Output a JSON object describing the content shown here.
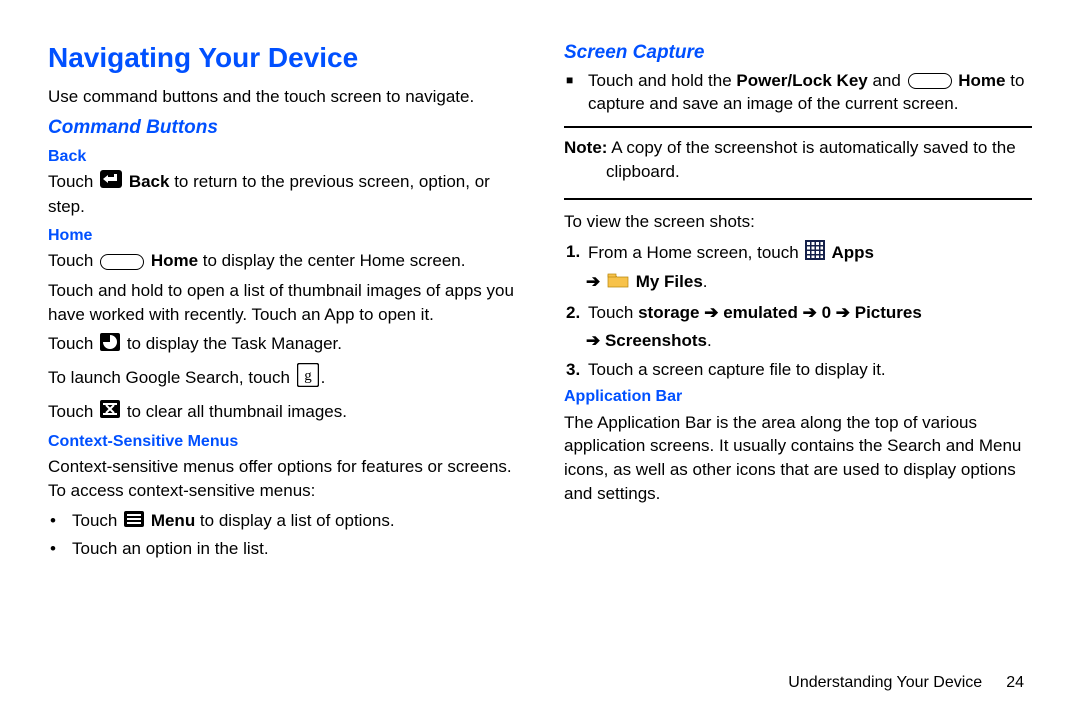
{
  "left": {
    "h1": "Navigating Your Device",
    "intro": "Use command buttons and the touch screen to navigate.",
    "h2_command": "Command Buttons",
    "back": {
      "heading": "Back",
      "p1a": "Touch ",
      "p1b": " Back",
      "p1c": " to return to the previous screen, option, or step."
    },
    "home": {
      "heading": "Home",
      "p1a": "Touch ",
      "p1b": " Home",
      "p1c": " to display the center Home screen.",
      "p2": "Touch and hold to open a list of thumbnail images of apps you have worked with recently. Touch an App to open it.",
      "p3a": "Touch ",
      "p3b": " to display the Task Manager.",
      "p4a": "To launch Google Search, touch ",
      "p4b": ".",
      "p5a": "Touch ",
      "p5b": " to clear all thumbnail images."
    },
    "context": {
      "heading": "Context-Sensitive Menus",
      "p1": "Context-sensitive menus offer options for features or screens. To access context-sensitive menus:",
      "b1a": "Touch ",
      "b1b": " Menu",
      "b1c": " to display a list of options.",
      "b2": "Touch an option in the list."
    }
  },
  "right": {
    "h2_screen": "Screen Capture",
    "cap1a": "Touch and hold the ",
    "cap1b": "Power/Lock Key",
    "cap1c": " and ",
    "cap1d": " Home",
    "cap1e": " to capture and save an image of the current screen.",
    "note_label": "Note:",
    "note_body": " A copy of the screenshot is automatically saved to the clipboard.",
    "view_intro": "To view the screen shots:",
    "s1a": "From a Home screen, touch ",
    "s1b": " Apps",
    "s1arrow": "➔ ",
    "s1c": " My Files",
    "s1d": ".",
    "s2a": "Touch ",
    "s2b": "storage",
    "s2c": " ➔ ",
    "s2d": "emulated",
    "s2e": " ➔ ",
    "s2f": "0",
    "s2g": " ➔ ",
    "s2h": "Pictures",
    "s2i": "➔ Screenshots",
    "s2j": ".",
    "s3": "Touch a screen capture file to display it.",
    "appbar": {
      "heading": "Application Bar",
      "p1": "The Application Bar is the area along the top of various application screens. It usually contains the Search and Menu icons, as well as other icons that are used to display options and settings."
    }
  },
  "footer": {
    "section": "Understanding Your Device",
    "page": "24"
  },
  "numbers": {
    "n1": "1.",
    "n2": "2.",
    "n3": "3."
  },
  "bullet_dot": "•"
}
